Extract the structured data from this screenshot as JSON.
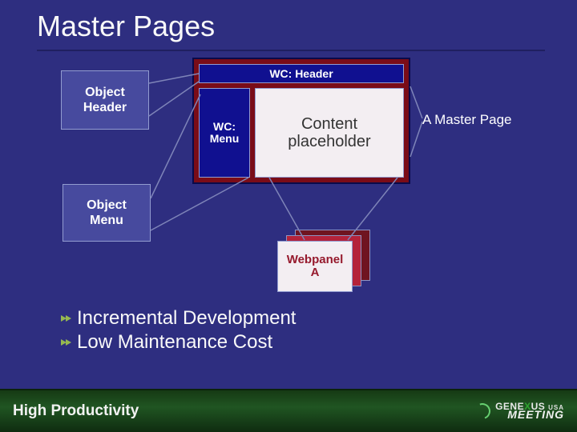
{
  "title": "Master Pages",
  "master": {
    "header": "WC: Header",
    "menu_line1": "WC:",
    "menu_line2": "Menu",
    "content_line1": "Content",
    "content_line2": "placeholder"
  },
  "callouts": {
    "obj_header_line1": "Object",
    "obj_header_line2": "Header",
    "obj_menu_line1": "Object",
    "obj_menu_line2": "Menu",
    "master_page_label": "A Master Page"
  },
  "webpanel": {
    "line1": "Webpanel",
    "line2": "A"
  },
  "bullets": {
    "item1": "Incremental Development",
    "item2": "Low Maintenance Cost"
  },
  "footer": {
    "text": "High Productivity",
    "logo_brand": "GENEXUS",
    "logo_region": "USA",
    "logo_event": "MEETING"
  }
}
